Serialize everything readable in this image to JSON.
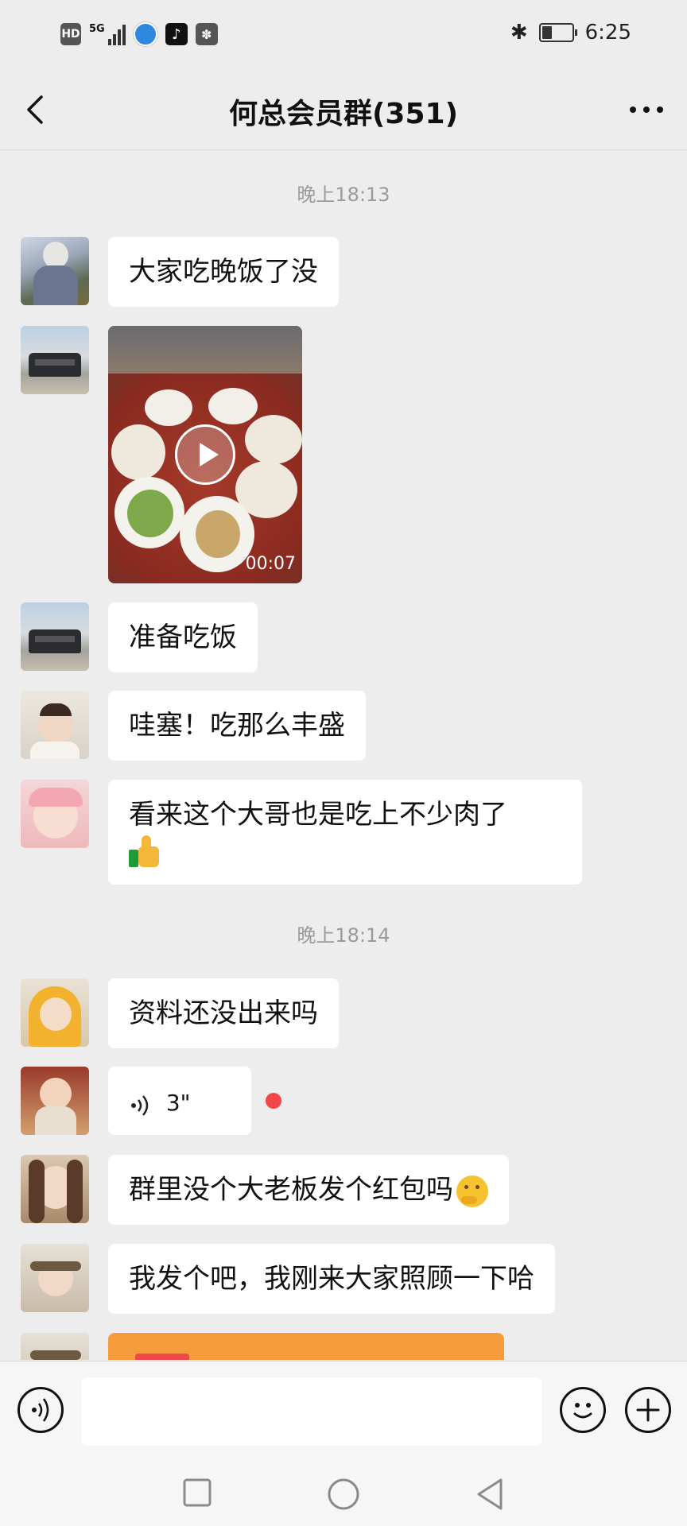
{
  "status_bar": {
    "network_badge": "HD",
    "signal_label": "5G",
    "time": "6:25",
    "icons": [
      "hd-icon",
      "signal-icon",
      "browser-icon",
      "tiktok-icon",
      "baidu-icon",
      "bluetooth-icon",
      "battery-icon"
    ]
  },
  "header": {
    "title": "何总会员群(351)"
  },
  "chat": {
    "timestamps": [
      "晚上18:13",
      "晚上18:14"
    ],
    "messages": [
      {
        "text": "大家吃晚饭了没"
      },
      {
        "video_duration": "00:07"
      },
      {
        "text": "准备吃饭"
      },
      {
        "text": "哇塞！吃那么丰盛"
      },
      {
        "text": "看来这个大哥也是吃上不少肉了"
      },
      {
        "text": "资料还没出来吗"
      },
      {
        "voice_duration": "3\""
      },
      {
        "text": "群里没个大老板发个红包吗"
      },
      {
        "text": "我发个吧，我刚来大家照顾一下哈"
      }
    ],
    "emojis": [
      "thumbs-up-emoji",
      "thinking-emoji"
    ]
  },
  "colors": {
    "bg": "#ededed",
    "bubble": "#ffffff",
    "red_packet": "#f79c3c",
    "unread_dot": "#f04848"
  }
}
